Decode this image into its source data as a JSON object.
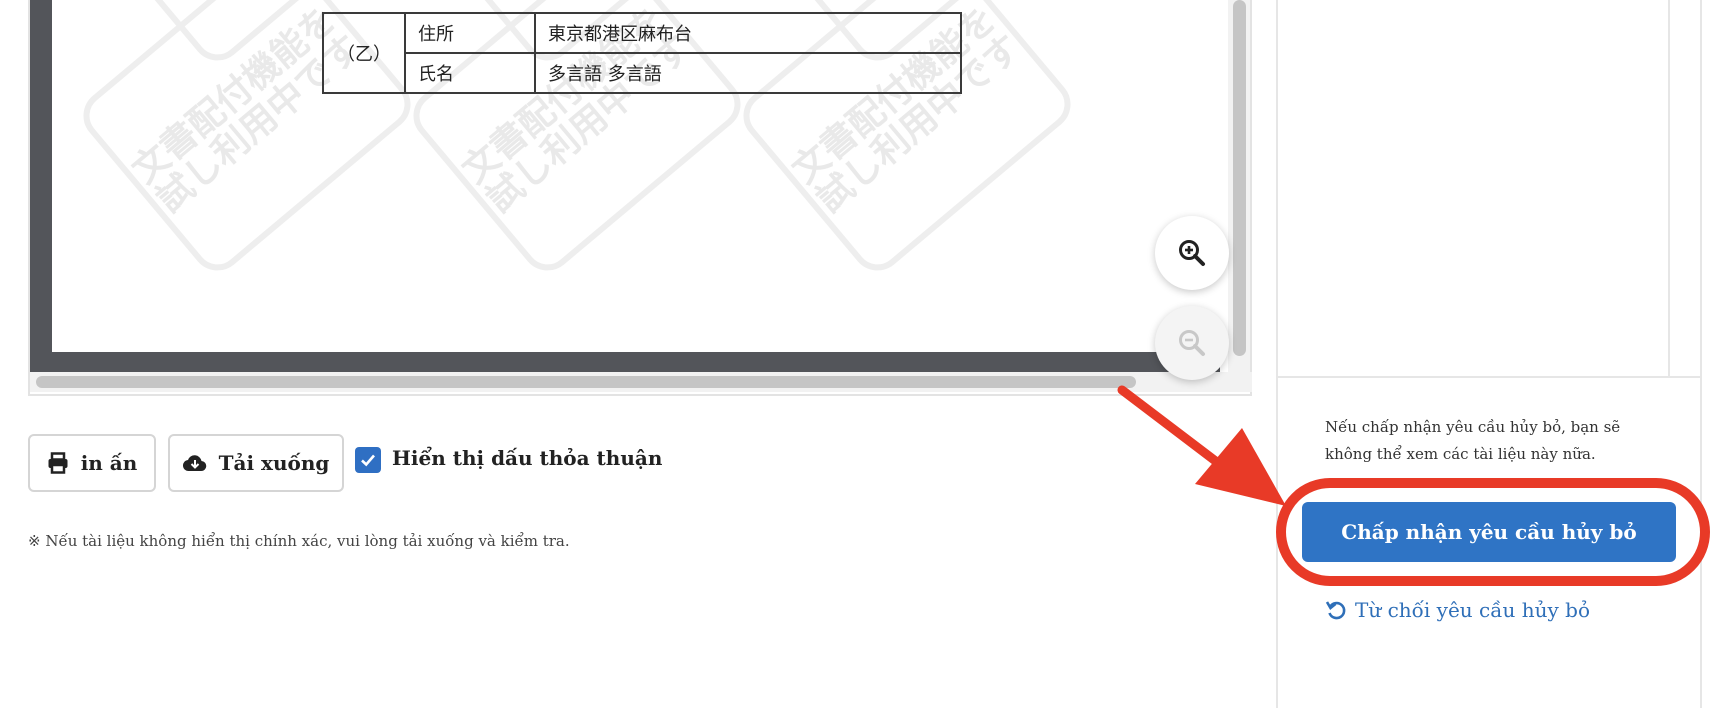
{
  "document": {
    "party_label": "（乙）",
    "rows": [
      {
        "field": "住所",
        "value": "東京都港区麻布台"
      },
      {
        "field": "氏名",
        "value": "多言語 多言語"
      }
    ],
    "watermark": "文書配付機能を\n試し利用中です"
  },
  "viewer": {
    "zoom_in_icon": "zoom-in-icon",
    "zoom_out_icon": "zoom-out-icon"
  },
  "toolbar": {
    "print_label": "in ấn",
    "download_label": "Tải xuống",
    "show_stamp_label": "Hiển thị dấu thỏa thuận",
    "show_stamp_checked": true
  },
  "note": "※ Nếu tài liệu không hiển thị chính xác, vui lòng tải xuống và kiểm tra.",
  "panel": {
    "message": "Nếu chấp nhận yêu cầu hủy bỏ, bạn sẽ không thể xem các tài liệu này nữa.",
    "accept_label": "Chấp nhận yêu cầu hủy bỏ",
    "reject_label": "Từ chối yêu cầu hủy bỏ"
  },
  "colors": {
    "accent": "#2f74c5",
    "annotation": "#e83a27"
  }
}
